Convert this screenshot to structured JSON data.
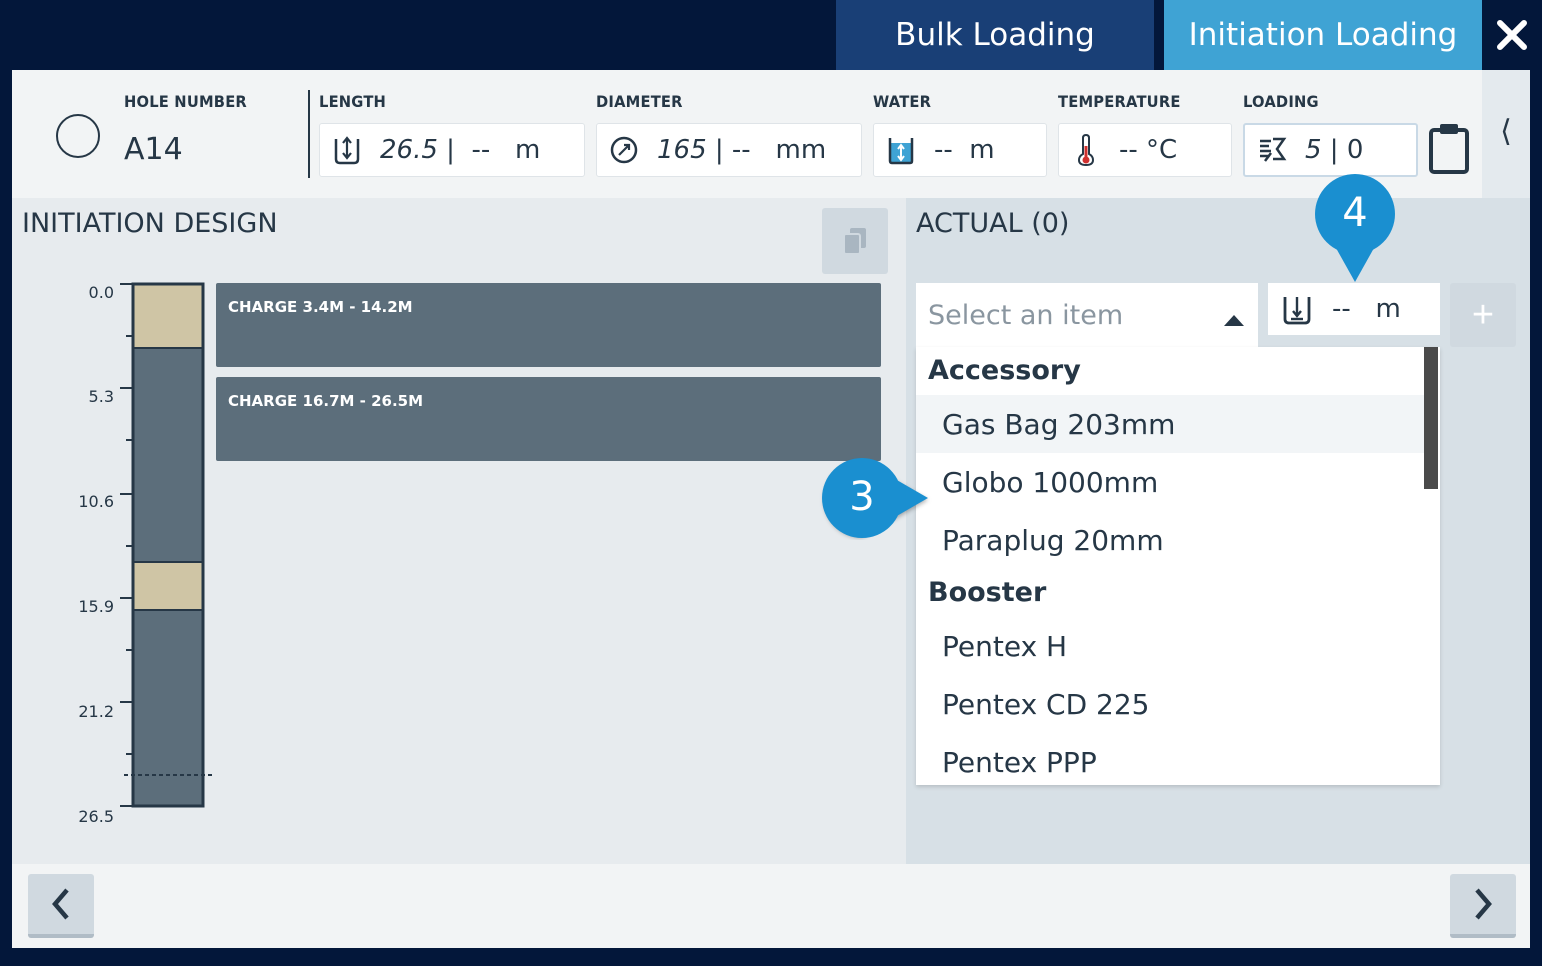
{
  "tabs": {
    "bulk": "Bulk Loading",
    "initiation": "Initiation Loading",
    "close_icon": "close-icon"
  },
  "header": {
    "hole_number_label": "HOLE NUMBER",
    "hole_number": "A14",
    "length_label": "LENGTH",
    "length_value": "26.5",
    "length_rest": " |  --   m",
    "diameter_label": "DIAMETER",
    "diameter_value": "165",
    "diameter_rest": " | --   mm",
    "water_label": "WATER",
    "water_value": "--  m",
    "temperature_label": "TEMPERATURE",
    "temperature_value": "-- °C",
    "loading_label": "LOADING",
    "loading_value": "5",
    "loading_rest": " | 0",
    "side_toggle": "⟨"
  },
  "design": {
    "title": "INITIATION DESIGN",
    "ticks": [
      "0.0",
      "5.3",
      "10.6",
      "15.9",
      "21.2",
      "26.5"
    ],
    "charges": [
      "CHARGE 3.4M - 14.2M",
      "CHARGE 16.7M - 26.5M"
    ]
  },
  "actual": {
    "title": "ACTUAL (0)",
    "select_placeholder": "Select an item",
    "depth_value": "--   m",
    "add_label": "+",
    "dropdown": {
      "group1": "Accessory",
      "items1": [
        "Gas Bag 203mm",
        "Globo 1000mm",
        "Paraplug 20mm"
      ],
      "group2": "Booster",
      "items2": [
        "Pentex H",
        "Pentex CD 225",
        "Pentex PPP"
      ]
    }
  },
  "callouts": {
    "c3": "3",
    "c4": "4"
  },
  "colors": {
    "background": "#03173a",
    "tab_bulk": "#193f76",
    "tab_initiation": "#3fa3d4",
    "charge": "#5c6e7b",
    "stem": "#cfc5a5",
    "callout": "#1a8fd0"
  }
}
